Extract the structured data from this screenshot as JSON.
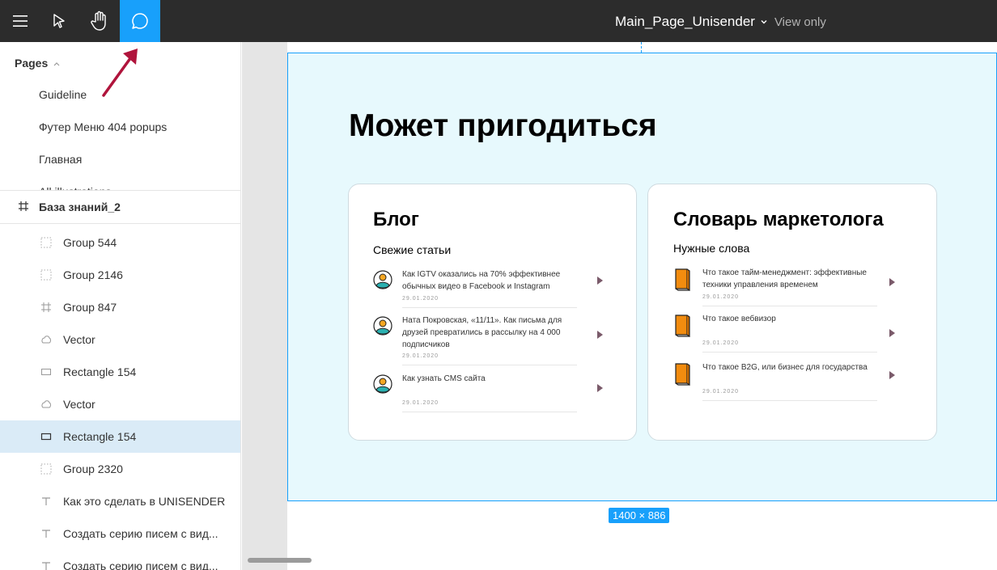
{
  "toolbar": {
    "menu_icon": "hamburger-menu-icon",
    "move_icon": "pointer-cursor-icon",
    "hand_icon": "hand-tool-icon",
    "comment_icon": "comment-bubble-icon"
  },
  "header": {
    "title": "Main_Page_Unisender",
    "mode": "View only"
  },
  "pages": {
    "heading": "Pages",
    "items": [
      "Guideline",
      "Футер Меню 404 popups",
      "Главная",
      "All illustrations"
    ]
  },
  "layers": {
    "frame_name": "База знаний_2",
    "items": [
      {
        "label": "Group 544",
        "icon": "group-icon"
      },
      {
        "label": "Group 2146",
        "icon": "group-icon"
      },
      {
        "label": "Group 847",
        "icon": "frame-icon"
      },
      {
        "label": "Vector",
        "icon": "vector-icon"
      },
      {
        "label": "Rectangle 154",
        "icon": "rectangle-icon"
      },
      {
        "label": "Vector",
        "icon": "vector-icon"
      },
      {
        "label": "Rectangle 154",
        "icon": "rectangle-icon"
      },
      {
        "label": "Group 2320",
        "icon": "group-icon"
      },
      {
        "label": "Как это сделать в UNISENDER",
        "icon": "text-icon"
      },
      {
        "label": "Создать серию писем с вид...",
        "icon": "text-icon"
      },
      {
        "label": "Создать серию писем с вид...",
        "icon": "text-icon"
      }
    ]
  },
  "canvas": {
    "size_badge": "1400 × 886",
    "heading": "Может пригодиться",
    "blog": {
      "title": "Блог",
      "subtitle": "Свежие статьи",
      "articles": [
        {
          "text": "Как IGTV оказались на 70% эффективнее обычных видео в Facebook и Instagram",
          "date": "29.01.2020"
        },
        {
          "text": "Ната Покровская, «11/11». Как письма для друзей превратились в рассылку на 4 000 подписчиков",
          "date": "29.01.2020"
        },
        {
          "text": "Как узнать CMS сайта",
          "date": "29.01.2020"
        }
      ]
    },
    "glossary": {
      "title": "Словарь маркетолога",
      "subtitle": "Нужные слова",
      "articles": [
        {
          "text": "Что такое тайм-менеджмент: эффективные техники управления временем",
          "date": "29.01.2020"
        },
        {
          "text": "Что такое вебвизор",
          "date": "29.01.2020"
        },
        {
          "text": "Что такое B2G, или бизнес для государства",
          "date": "29.01.2020"
        }
      ]
    }
  },
  "colors": {
    "topbar": "#2c2c2c",
    "accent": "#18a0fb",
    "frame_bg": "#e7f9fd",
    "selected_layer": "#daebf7",
    "annotation_arrow": "#b0143c"
  }
}
